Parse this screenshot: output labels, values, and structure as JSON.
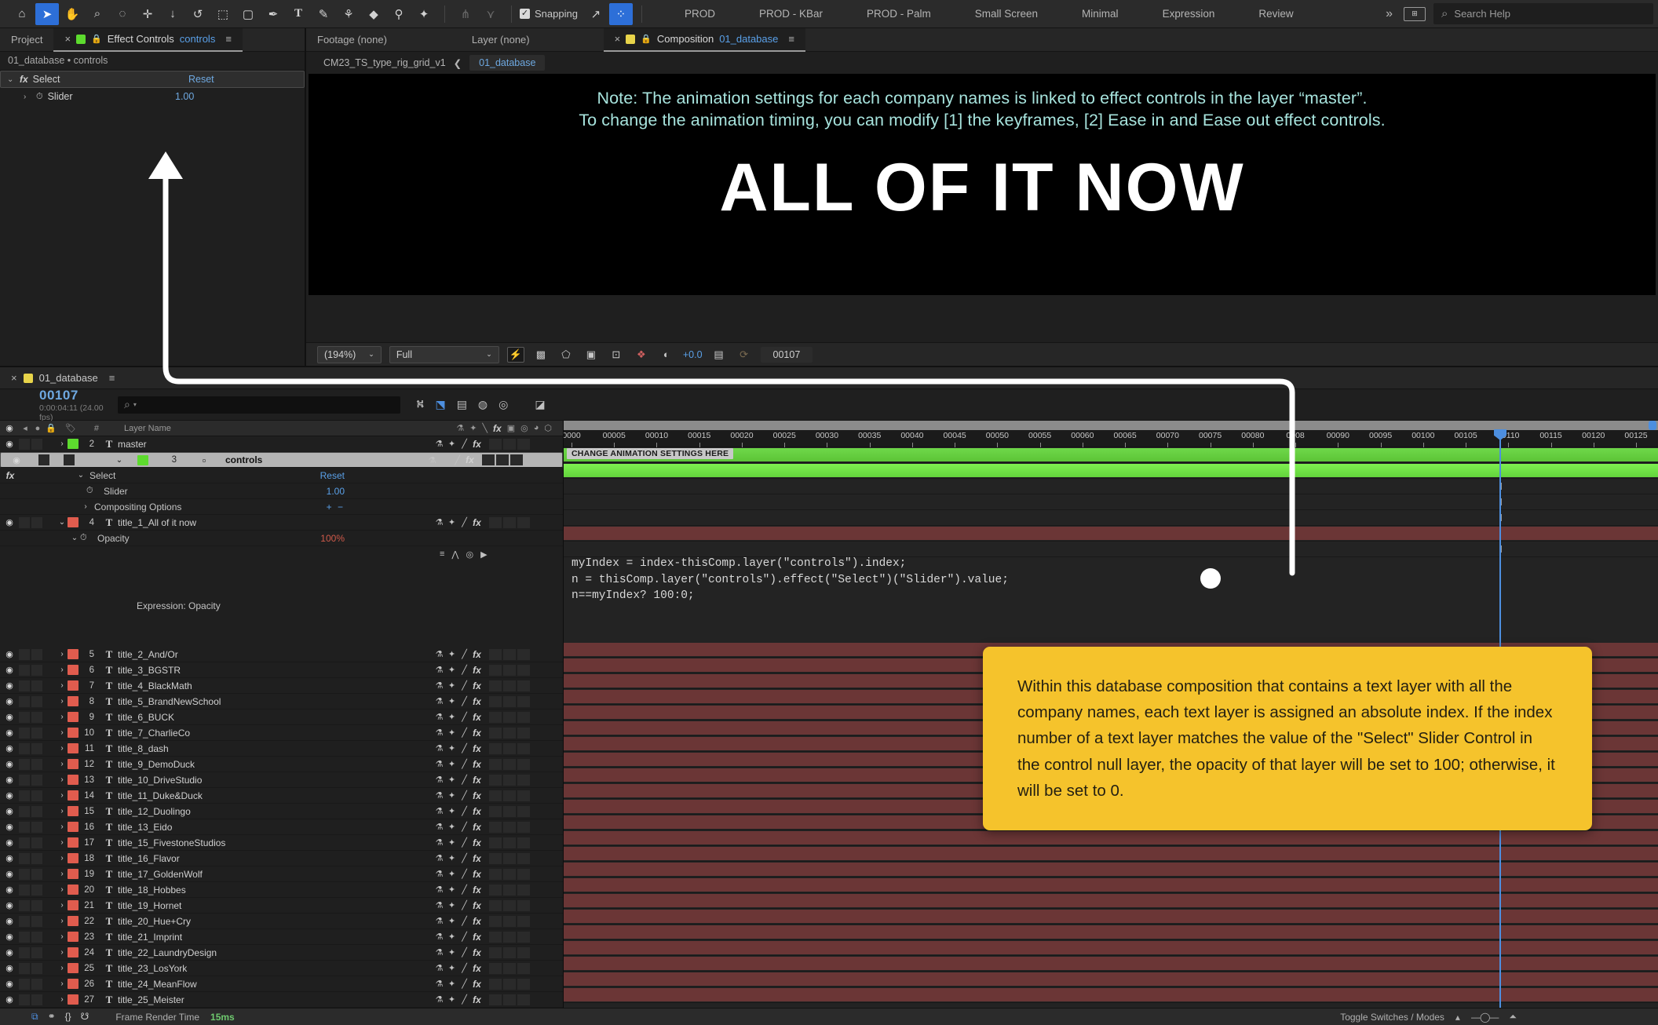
{
  "toolbar": {
    "tools": [
      {
        "name": "home-icon",
        "glyph": "⌂"
      },
      {
        "name": "selection-tool-icon",
        "glyph": "➤"
      },
      {
        "name": "hand-tool-icon",
        "glyph": "✋"
      },
      {
        "name": "zoom-tool-icon",
        "glyph": "🔍"
      },
      {
        "name": "orbit-tool-icon",
        "glyph": "◌"
      },
      {
        "name": "pan-behind-tool-icon",
        "glyph": "✛"
      },
      {
        "name": "camera-dolly-tool-icon",
        "glyph": "↓"
      },
      {
        "name": "rotation-tool-icon",
        "glyph": "↺"
      },
      {
        "name": "roto-brush-tool-icon",
        "glyph": "⬚"
      },
      {
        "name": "shape-tool-icon",
        "glyph": "▢"
      },
      {
        "name": "pen-tool-icon",
        "glyph": "✒"
      },
      {
        "name": "type-tool-icon",
        "glyph": "T"
      },
      {
        "name": "brush-tool-icon",
        "glyph": "✎"
      },
      {
        "name": "clone-stamp-tool-icon",
        "glyph": "⚑"
      },
      {
        "name": "eraser-tool-icon",
        "glyph": "◆"
      },
      {
        "name": "puppet-pin-tool-icon",
        "glyph": "⚲"
      },
      {
        "name": "pin-tool-icon",
        "glyph": "✦"
      }
    ],
    "dim_tools": [
      {
        "name": "puppet-starch-tool-icon",
        "glyph": "⋔"
      },
      {
        "name": "puppet-overlap-tool-icon",
        "glyph": "⋎"
      }
    ],
    "snapping_label": "Snapping",
    "snap_check": "✓",
    "snap_icons": [
      {
        "name": "snap-align-icon",
        "glyph": "↗"
      },
      {
        "name": "snap-grid-icon",
        "glyph": "⁘"
      }
    ],
    "workspaces": [
      "PROD",
      "PROD - KBar",
      "PROD - Palm",
      "Small Screen",
      "Minimal",
      "Expression",
      "Review"
    ],
    "overflow_glyph": "»",
    "workspace_icon_label": "⊞",
    "search_placeholder": "Search Help",
    "search_icon": "⌕"
  },
  "effect_controls": {
    "tabs": [
      {
        "name": "project-tab",
        "label": "Project",
        "active": false
      },
      {
        "name": "effect-controls-tab",
        "label": "Effect Controls",
        "suffix": "controls",
        "active": true
      }
    ],
    "close_glyph": "×",
    "lock_glyph": "🔒",
    "menu_glyph": "≡",
    "breadcrumb": "01_database • controls",
    "swatch_color": "#5ddb2e",
    "rows": [
      {
        "name": "effect-select",
        "label": "Select",
        "value": "Reset",
        "kind": "effect"
      },
      {
        "name": "property-slider",
        "label": "Slider",
        "value": "1.00",
        "kind": "property"
      }
    ]
  },
  "viewer": {
    "tabs": [
      {
        "name": "footage-tab",
        "label": "Footage (none)",
        "active": false
      },
      {
        "name": "layer-tab",
        "label": "Layer (none)",
        "active": false
      },
      {
        "name": "composition-tab",
        "label": "Composition",
        "suffix": "01_database",
        "active": true
      }
    ],
    "swatch_color": "#e8d44a",
    "breadcrumb_parent": "CM23_TS_type_rig_grid_v1",
    "breadcrumb_sep": "❮",
    "breadcrumb_current": "01_database",
    "canvas": {
      "note_line1": "Note: The animation settings for each company names is linked to effect controls in the layer “master”.",
      "note_line2": "To change the animation timing, you can modify [1] the keyframes, [2] Ease in and Ease out effect controls.",
      "note_color": "#a7e3dd",
      "title": "ALL OF IT NOW"
    },
    "bottom_bar": {
      "zoom": "(194%)",
      "resolution": "Full",
      "icons": [
        {
          "name": "fast-previews-icon",
          "glyph": "⚡",
          "active": true
        },
        {
          "name": "transparency-grid-icon",
          "glyph": "▩",
          "active": false
        },
        {
          "name": "mask-shape-icon",
          "glyph": "⬠",
          "active": false
        },
        {
          "name": "region-of-interest-icon",
          "glyph": "▣",
          "active": false
        },
        {
          "name": "view-options-icon",
          "glyph": "⊡",
          "active": false
        }
      ],
      "channel_icon": "❖",
      "exposure_icon": "◐",
      "exposure_value": "+0.0",
      "snapshot_icon": "📷",
      "show_snapshot_icon": "⟳",
      "timecode": "00107"
    }
  },
  "timeline": {
    "tab": {
      "name": "timeline-tab-01-database",
      "label": "01_database",
      "swatch_color": "#e8d44a",
      "close_glyph": "×",
      "menu_glyph": "≡"
    },
    "current_time": "00107",
    "current_time_sub": "0:00:04:11 (24.00 fps)",
    "search_placeholder": "",
    "search_icon": "⌕",
    "header_icons": [
      {
        "name": "composition-mini-flowchart-icon",
        "glyph": "⛕"
      },
      {
        "name": "draft-3d-icon",
        "glyph": "⬔"
      },
      {
        "name": "hide-shy-layers-icon",
        "glyph": "▤"
      },
      {
        "name": "frame-blending-icon",
        "glyph": "◍"
      },
      {
        "name": "motion-blur-icon",
        "glyph": "◎"
      },
      {
        "name": "graph-editor-icon",
        "glyph": "◪"
      }
    ],
    "columns": {
      "av_icons": [
        "◉",
        "◀",
        "●",
        "🔒"
      ],
      "label_icon": "🏷",
      "index": "#",
      "layer_name": "Layer Name",
      "switch_icons": [
        "⚗",
        "✦",
        "╲",
        "fx",
        "▣",
        "◎",
        "◕",
        "⬡"
      ]
    },
    "layers": [
      {
        "index": "2",
        "name": "master",
        "type": "T",
        "label_color": "#5ddb2e",
        "expanded": false,
        "selected": false,
        "row": "layer"
      },
      {
        "index": "3",
        "name": "controls",
        "type": "□",
        "label_color": "#5ddb2e",
        "expanded": true,
        "selected": true,
        "row": "layer"
      },
      {
        "index": "",
        "name": "Select",
        "type": "",
        "label_color": "",
        "row": "effect",
        "value": "Reset",
        "indent": 96,
        "fx": true
      },
      {
        "index": "",
        "name": "Slider",
        "type": "",
        "label_color": "",
        "row": "property",
        "value": "1.00",
        "indent": 118
      },
      {
        "index": "",
        "name": "Compositing Options",
        "type": "",
        "label_color": "",
        "row": "group",
        "value": "+ −",
        "indent": 106
      },
      {
        "index": "4",
        "name": "title_1_All of it now",
        "type": "T",
        "label_color": "#e05c4e",
        "expanded": true,
        "selected": false,
        "row": "layer"
      },
      {
        "index": "",
        "name": "Opacity",
        "type": "",
        "label_color": "",
        "row": "property",
        "value": "100%",
        "indent": 96
      },
      {
        "index": "",
        "name": "Expression: Opacity",
        "type": "",
        "label_color": "",
        "row": "expression-label",
        "indent": 118
      }
    ],
    "expression_icons": [
      "≡",
      "⋀",
      "◎",
      "▶"
    ],
    "title_layers": [
      {
        "index": "5",
        "name": "title_2_And/Or"
      },
      {
        "index": "6",
        "name": "title_3_BGSTR"
      },
      {
        "index": "7",
        "name": "title_4_BlackMath"
      },
      {
        "index": "8",
        "name": "title_5_BrandNewSchool"
      },
      {
        "index": "9",
        "name": "title_6_BUCK"
      },
      {
        "index": "10",
        "name": "title_7_CharlieCo"
      },
      {
        "index": "11",
        "name": "title_8_dash"
      },
      {
        "index": "12",
        "name": "title_9_DemoDuck"
      },
      {
        "index": "13",
        "name": "title_10_DriveStudio"
      },
      {
        "index": "14",
        "name": "title_11_Duke&Duck"
      },
      {
        "index": "15",
        "name": "title_12_Duolingo"
      },
      {
        "index": "16",
        "name": "title_13_Eido"
      },
      {
        "index": "17",
        "name": "title_15_FivestoneStudios"
      },
      {
        "index": "18",
        "name": "title_16_Flavor"
      },
      {
        "index": "19",
        "name": "title_17_GoldenWolf"
      },
      {
        "index": "20",
        "name": "title_18_Hobbes"
      },
      {
        "index": "21",
        "name": "title_19_Hornet"
      },
      {
        "index": "22",
        "name": "title_20_Hue+Cry"
      },
      {
        "index": "23",
        "name": "title_21_Imprint"
      },
      {
        "index": "24",
        "name": "title_22_LaundryDesign"
      },
      {
        "index": "25",
        "name": "title_23_LosYork"
      },
      {
        "index": "26",
        "name": "title_24_MeanFlow"
      },
      {
        "index": "27",
        "name": "title_25_Meister"
      }
    ],
    "title_label_color": "#e05c4e",
    "ruler_labels": [
      "0000",
      "00005",
      "00010",
      "00015",
      "00020",
      "00025",
      "00030",
      "00035",
      "00040",
      "00045",
      "00050",
      "00055",
      "00060",
      "00065",
      "00070",
      "00075",
      "00080",
      "0008",
      "00090",
      "00095",
      "00100",
      "00105",
      "00110",
      "00115",
      "00120",
      "00125"
    ],
    "marker_label": "CHANGE ANIMATION SETTINGS HERE",
    "expression_code": "myIndex = index-thisComp.layer(\"controls\").index;\nn = thisComp.layer(\"controls\").effect(\"Select\")(\"Slider\").value;\nn==myIndex? 100:0;",
    "callout_text": "Within this database composition that contains a text layer with all the company names, each text layer is assigned an absolute index. If the index number of a text layer matches the value of the \"Select\" Slider Control in the control null layer, the opacity of that layer will be set to 100; otherwise, it will be set to 0.",
    "callout_bg": "#f5c32c",
    "status": {
      "icons": [
        "⧉",
        "⚭",
        "{}",
        "☋"
      ],
      "render_time_label": "Frame Render Time",
      "render_time_value": "15ms",
      "toggle_switches": "Toggle Switches / Modes",
      "zoom_icons": [
        "▴",
        "▬",
        "◯",
        "▬",
        "⏶"
      ]
    }
  }
}
